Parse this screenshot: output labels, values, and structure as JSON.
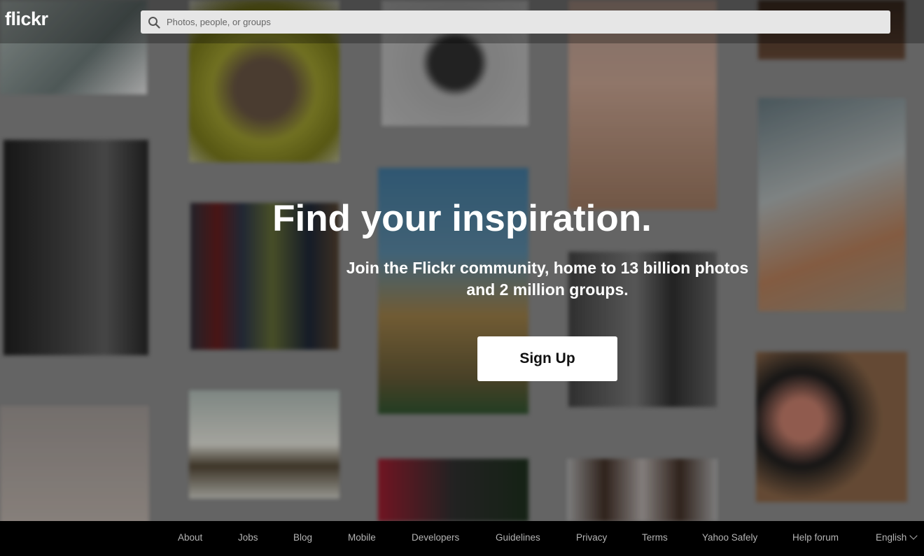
{
  "header": {
    "logo": "flickr",
    "search_placeholder": "Photos, people, or groups",
    "search_icon": "search-icon"
  },
  "hero": {
    "title": "Find your inspiration.",
    "subtitle_line1": "Join the Flickr community, home to 13 billion photos",
    "subtitle_line2": "and 2 million groups.",
    "signup_label": "Sign Up"
  },
  "footer": {
    "links": [
      "About",
      "Jobs",
      "Blog",
      "Mobile",
      "Developers",
      "Guidelines",
      "Privacy",
      "Terms",
      "Yahoo Safely",
      "Help forum"
    ],
    "language": "English"
  },
  "colors": {
    "footer_bg": "#000000",
    "footer_text": "#b4b4b4",
    "button_bg": "#ffffff"
  }
}
